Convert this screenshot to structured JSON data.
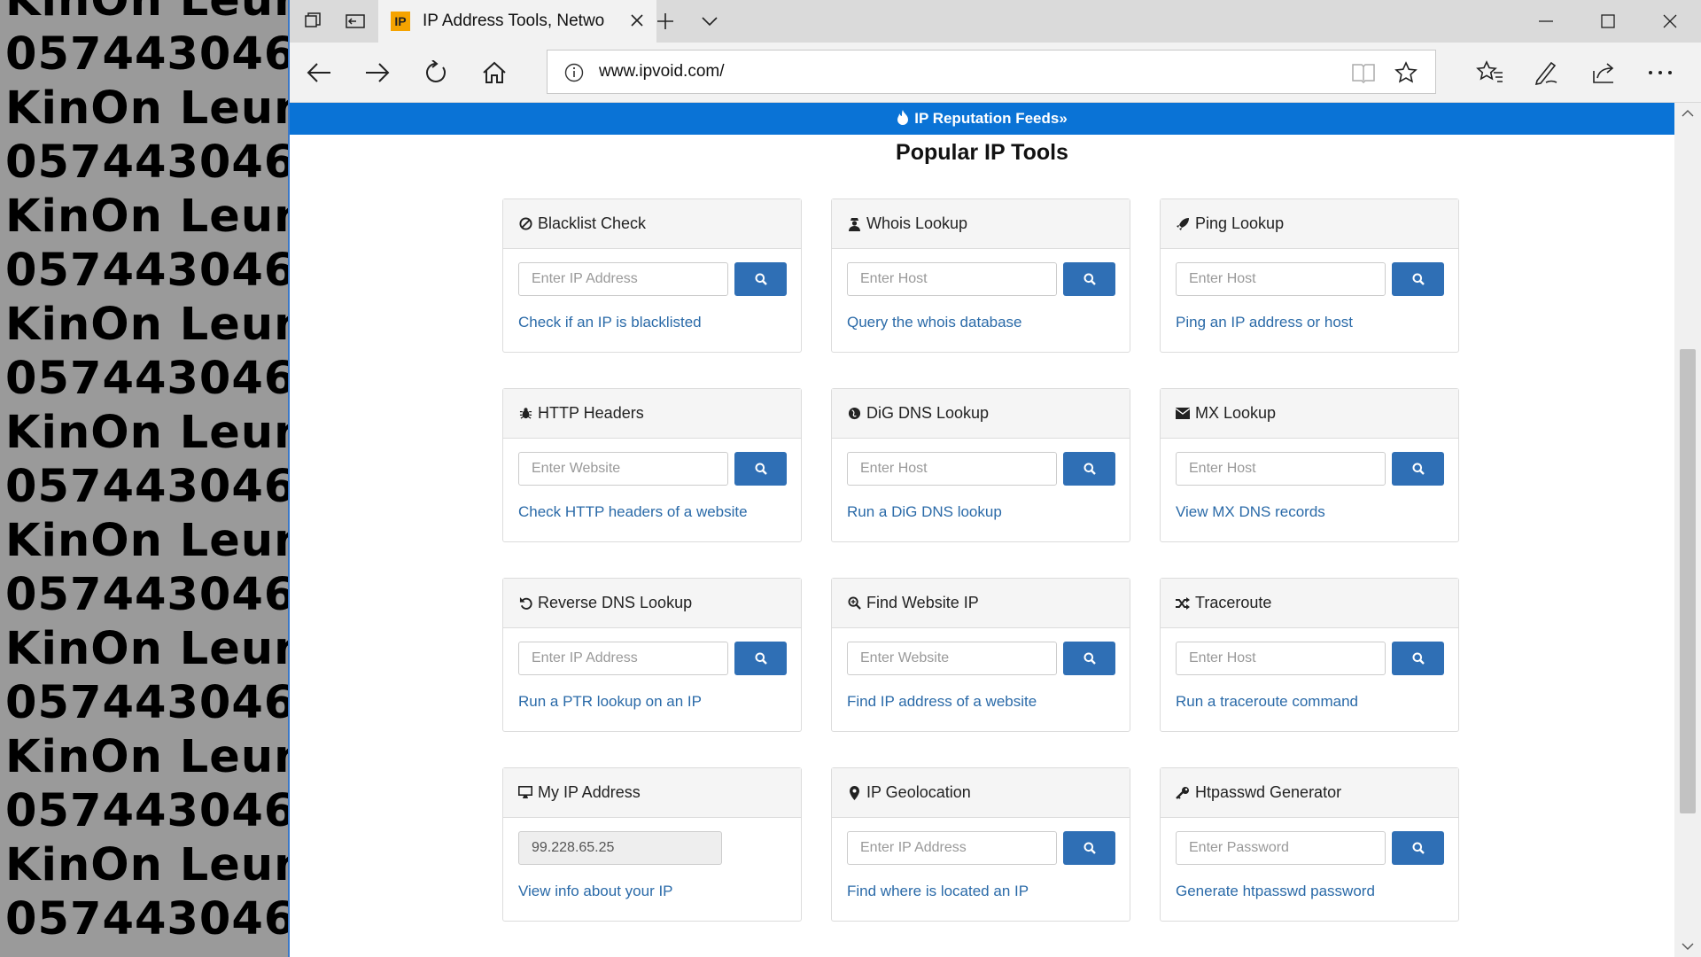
{
  "watermark": {
    "lines": [
      "KinOn Leung",
      "057443046",
      "KinOn Leung",
      "057443046",
      "KinOn Leung",
      "057443046",
      "KinOn Leung",
      "057443046",
      "KinOn Leung",
      "057443046",
      "KinOn Leung",
      "057443046",
      "KinOn Leung",
      "057443046",
      "KinOn Leung",
      "057443046",
      "KinOn Leung",
      "057443046"
    ]
  },
  "browser": {
    "tab_title": "IP Address Tools, Netwo",
    "favicon_text": "IP",
    "url": "www.ipvoid.com/"
  },
  "page": {
    "banner": "IP Reputation Feeds»",
    "title": "Popular IP Tools",
    "cards": [
      {
        "title": "Blacklist Check",
        "icon": "ban-icon",
        "placeholder": "Enter IP Address",
        "link": "Check if an IP is blacklisted"
      },
      {
        "title": "Whois Lookup",
        "icon": "user-secret-icon",
        "placeholder": "Enter Host",
        "link": "Query the whois database"
      },
      {
        "title": "Ping Lookup",
        "icon": "rocket-icon",
        "placeholder": "Enter Host",
        "link": "Ping an IP address or host"
      },
      {
        "title": "HTTP Headers",
        "icon": "bug-icon",
        "placeholder": "Enter Website",
        "link": "Check HTTP headers of a website"
      },
      {
        "title": "DiG DNS Lookup",
        "icon": "globe-icon",
        "placeholder": "Enter Host",
        "link": "Run a DiG DNS lookup"
      },
      {
        "title": "MX Lookup",
        "icon": "envelope-icon",
        "placeholder": "Enter Host",
        "link": "View MX DNS records"
      },
      {
        "title": "Reverse DNS Lookup",
        "icon": "undo-icon",
        "placeholder": "Enter IP Address",
        "link": "Run a PTR lookup on an IP"
      },
      {
        "title": "Find Website IP",
        "icon": "search-plus-icon",
        "placeholder": "Enter Website",
        "link": "Find IP address of a website"
      },
      {
        "title": "Traceroute",
        "icon": "random-icon",
        "placeholder": "Enter Host",
        "link": "Run a traceroute command"
      },
      {
        "title": "My IP Address",
        "icon": "desktop-icon",
        "value": "99.228.65.25",
        "link": "View info about your IP"
      },
      {
        "title": "IP Geolocation",
        "icon": "map-marker-icon",
        "placeholder": "Enter IP Address",
        "link": "Find where is located an IP"
      },
      {
        "title": "Htpasswd Generator",
        "icon": "key-icon",
        "placeholder": "Enter Password",
        "link": "Generate htpasswd password"
      }
    ]
  },
  "colors": {
    "banner": "#0a73d6",
    "button": "#2f6fb5",
    "link": "#2a6aa8"
  }
}
